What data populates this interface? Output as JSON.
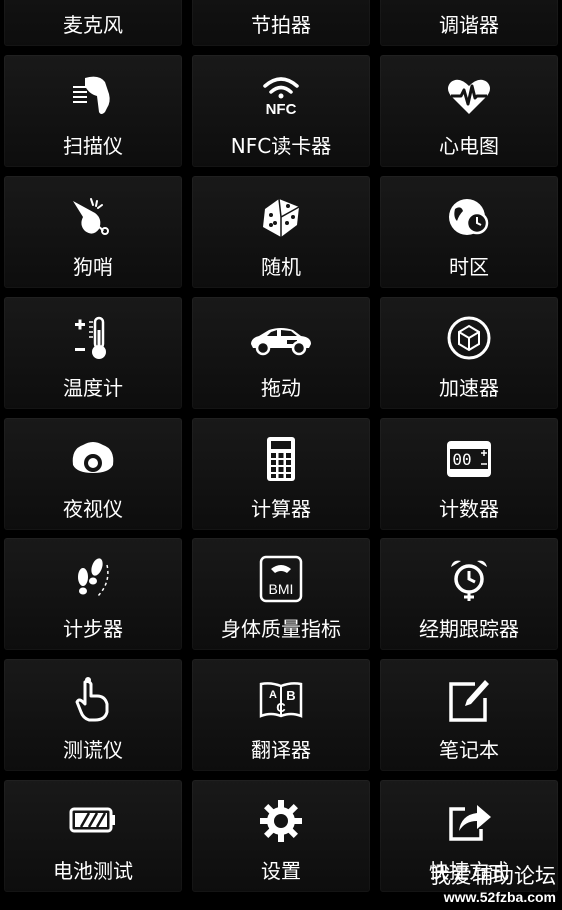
{
  "top_row": [
    {
      "label": "麦克风"
    },
    {
      "label": "节拍器"
    },
    {
      "label": "调谐器"
    }
  ],
  "tiles": [
    {
      "label": "扫描仪",
      "icon": "barcode-scanner-icon"
    },
    {
      "label": "NFC读卡器",
      "icon": "nfc-icon",
      "icon_text": "NFC"
    },
    {
      "label": "心电图",
      "icon": "heart-pulse-icon"
    },
    {
      "label": "狗哨",
      "icon": "whistle-icon"
    },
    {
      "label": "随机",
      "icon": "dice-icon"
    },
    {
      "label": "时区",
      "icon": "globe-clock-icon"
    },
    {
      "label": "温度计",
      "icon": "thermometer-icon",
      "icon_text": "+ −"
    },
    {
      "label": "拖动",
      "icon": "car-icon"
    },
    {
      "label": "加速器",
      "icon": "cube-gauge-icon"
    },
    {
      "label": "夜视仪",
      "icon": "night-vision-icon"
    },
    {
      "label": "计算器",
      "icon": "calculator-icon"
    },
    {
      "label": "计数器",
      "icon": "counter-icon",
      "icon_text": "00"
    },
    {
      "label": "计步器",
      "icon": "footsteps-icon"
    },
    {
      "label": "身体质量指标",
      "icon": "bmi-scale-icon",
      "icon_text": "BMI"
    },
    {
      "label": "经期跟踪器",
      "icon": "alarm-clock-icon"
    },
    {
      "label": "测谎仪",
      "icon": "finger-touch-icon"
    },
    {
      "label": "翻译器",
      "icon": "translator-book-icon",
      "icon_text": "A B C"
    },
    {
      "label": "笔记本",
      "icon": "notebook-pen-icon"
    },
    {
      "label": "电池测试",
      "icon": "battery-icon"
    },
    {
      "label": "设置",
      "icon": "gear-icon"
    },
    {
      "label": "快捷方式",
      "icon": "share-arrow-icon"
    }
  ],
  "watermark": {
    "title": "我爱辅助论坛",
    "url": "www.52fzba.com"
  },
  "colors": {
    "background": "#000000",
    "tile": "#141414",
    "text": "#ffffff"
  }
}
